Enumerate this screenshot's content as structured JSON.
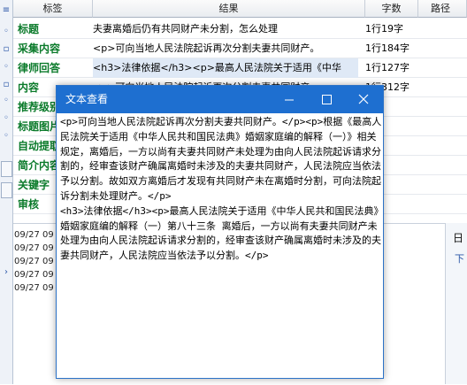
{
  "table": {
    "headers": [
      "标签",
      "结果",
      "字数",
      "路径"
    ],
    "rows": [
      {
        "label": "标题",
        "result": "夫妻离婚后仍有共同财产未分割，怎么处理",
        "count": "1行19字"
      },
      {
        "label": "采集内容",
        "result": "<p>可向当地人民法院起诉再次分割夫妻共同财产。",
        "count": "1行184字"
      },
      {
        "label": "律师回答",
        "result": "<h3>法律依据</h3><p>最高人民法院关于适用《中华",
        "count": "1行127字"
      },
      {
        "label": "内容",
        "result": "<p>可向当地人民法院起诉再次分割夫妻共同财产。",
        "count": "1行312字"
      },
      {
        "label": "推荐级别",
        "result": "",
        "count": ""
      },
      {
        "label": "标题图片",
        "result": "",
        "count": ""
      },
      {
        "label": "自动提取",
        "result": "",
        "count": ""
      },
      {
        "label": "简介内容",
        "result": "",
        "count": ""
      },
      {
        "label": "关键字",
        "result": "",
        "count": ""
      },
      {
        "label": "审核",
        "result": "",
        "count": ""
      }
    ]
  },
  "log": {
    "lines": [
      "09/27 09",
      "09/27 09",
      "09/27 09",
      "09/27 09",
      "09/27 09"
    ]
  },
  "side_panel": {
    "title": "日",
    "sub": "下"
  },
  "window": {
    "title": "文本查看",
    "content": "<p>可向当地人民法院起诉再次分割夫妻共同财产。</p><p>根据《最高人民法院关于适用《中华人民共和国民法典》婚姻家庭编的解释（一）》相关规定，离婚后，一方以尚有夫妻共同财产未处理为由向人民法院起诉请求分割的，经审查该财产确属离婚时未涉及的夫妻共同财产，人民法院应当依法予以分割。故如双方离婚后才发现有共同财产未在离婚时分割，可向法院起诉分割未处理财产。</p>\n<h3>法律依据</h3><p>最高人民法院关于适用《中华人民共和国民法典》婚姻家庭编的解释（一）第八十三条 离婚后，一方以尚有夫妻共同财产未处理为由向人民法院起诉请求分割的，经审查该财产确属离婚时未涉及的夫妻共同财产，人民法院应当依法予以分割。</p>"
  },
  "colors": {
    "accent": "#1e6fd0",
    "label_green": "#0a7a2a"
  },
  "icons": [
    "minimize-icon",
    "maximize-icon",
    "close-icon"
  ]
}
